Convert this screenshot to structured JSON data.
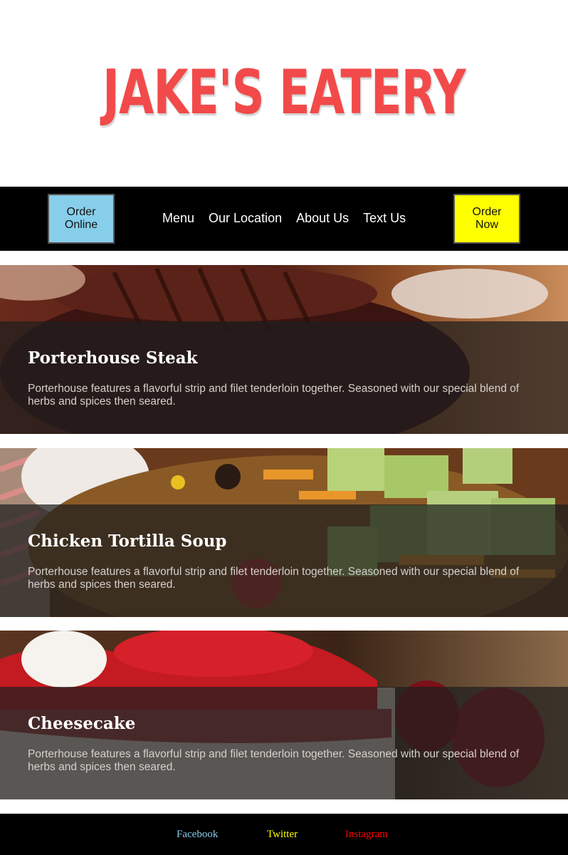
{
  "brand": {
    "name": "JAKE'S EATERY",
    "color": "#f24a4a"
  },
  "nav": {
    "order_online": {
      "label_line1": "Order",
      "label_line2": "Online",
      "bg": "#87ceeb"
    },
    "order_now": {
      "label_line1": "Order",
      "label_line2": "Now",
      "bg": "#ffff00"
    },
    "links": [
      "Menu",
      "Our Location",
      "About Us",
      "Text Us"
    ]
  },
  "menu_items": [
    {
      "title": "Porterhouse Steak",
      "description": "Porterhouse features a flavorful strip and filet tenderloin together. Seasoned with our special blend of herbs and spices then seared.",
      "image": "porterhouse-steak-photo"
    },
    {
      "title": "Chicken Tortilla Soup",
      "description": "Porterhouse features a flavorful strip and filet tenderloin together. Seasoned with our special blend of herbs and spices then seared.",
      "image": "chicken-tortilla-soup-photo"
    },
    {
      "title": "Cheesecake",
      "description": "Porterhouse features a flavorful strip and filet tenderloin together. Seasoned with our special blend of herbs and spices then seared.",
      "image": "cheesecake-photo"
    }
  ],
  "footer": {
    "links": [
      {
        "label": "Facebook",
        "color": "#87ceeb"
      },
      {
        "label": "Twitter",
        "color": "#ffff00"
      },
      {
        "label": "Instagram",
        "color": "#ff0000"
      }
    ]
  }
}
